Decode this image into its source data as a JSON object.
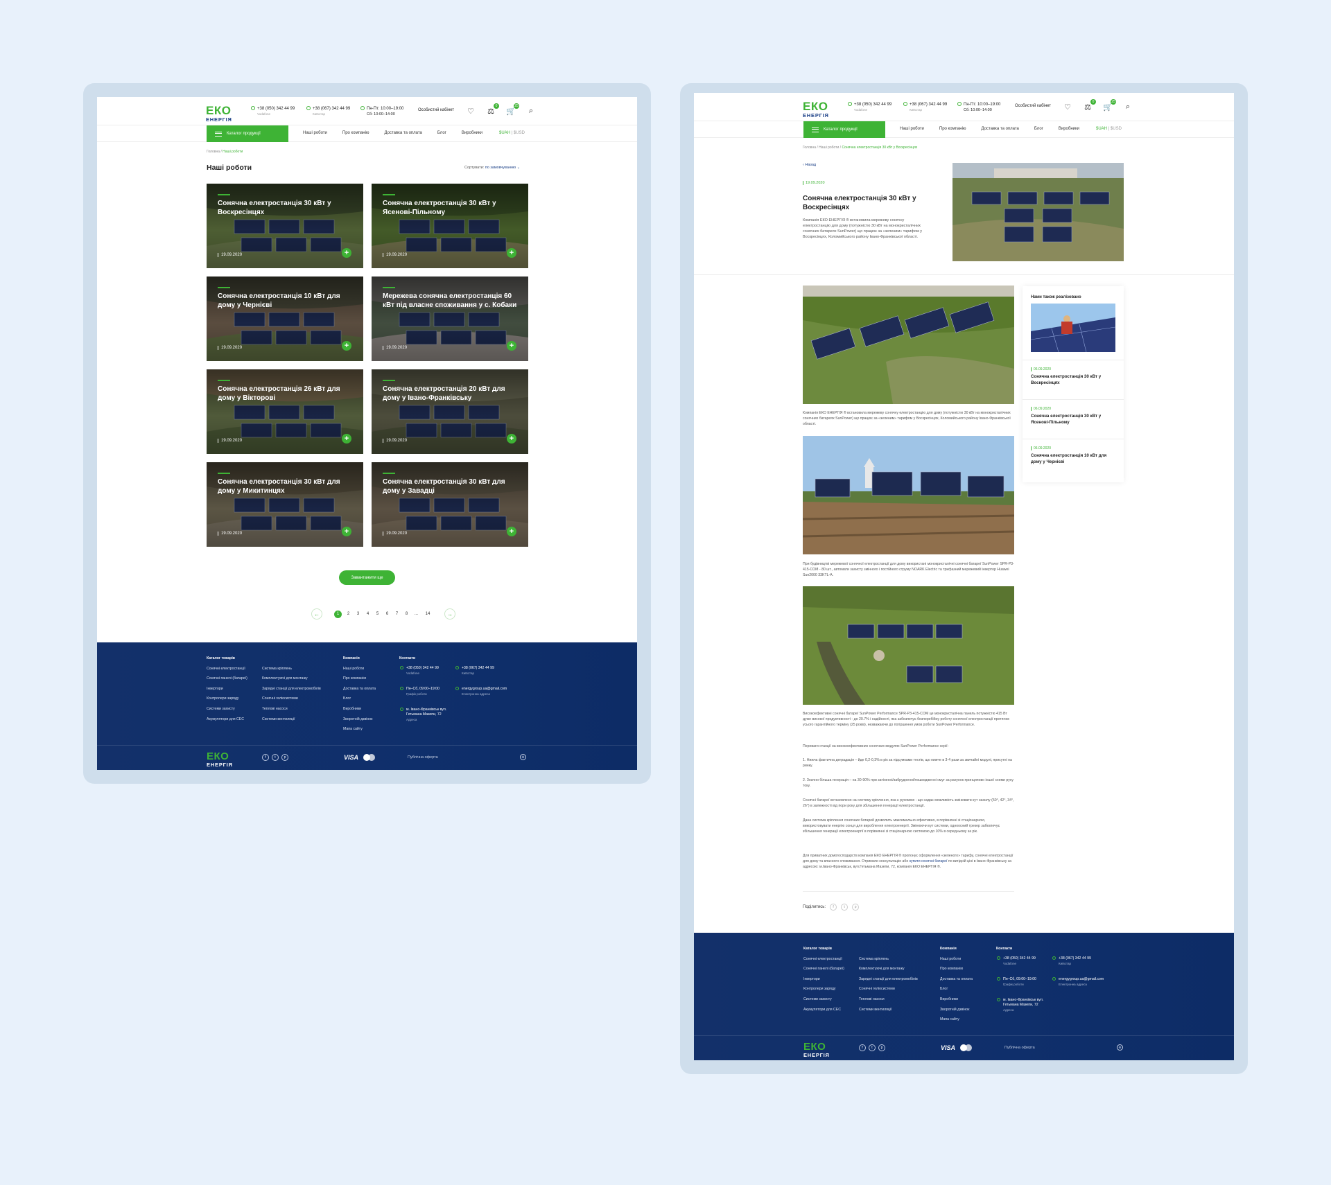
{
  "header": {
    "logo_top": "ЕКО",
    "logo_bottom": "ЕНЕРГІЯ",
    "phone1": "+38 (050) 342 44 99",
    "phone1_sub": "Vodafone",
    "phone2": "+38 (067) 342 44 99",
    "phone2_sub": "Київстар",
    "hours1": "Пн-Пт: 10:00–19:00",
    "hours2": "Сб: 10:00–14:00",
    "cabinet": "Особистий кабінет",
    "compare_count": "0",
    "cart_count": "25"
  },
  "nav": {
    "catalog": "Каталог продукції",
    "items": [
      "Наші роботи",
      "Про компанію",
      "Доставка та оплата",
      "Блог",
      "Виробники"
    ],
    "cur_uah": "$UAH",
    "cur_sep": "|",
    "cur_usd": "$USD"
  },
  "list_page": {
    "breadcrumb_home": "Головна",
    "breadcrumb_sep": " / ",
    "breadcrumb_current": "Наші роботи",
    "title": "Наші роботи",
    "sort_label": "Сортувати:",
    "sort_value": "по замовчуванню ⌄",
    "cards": [
      {
        "title": "Сонячна електростанція 30 кВт у Воскресінцях",
        "date": "19.09.2020"
      },
      {
        "title": "Сонячна електростанція 30 кВт у Ясенові-Пільному",
        "date": "19.09.2020"
      },
      {
        "title": "Сонячна електростанція 10 кВт для дому у Чернієві",
        "date": "19.09.2020"
      },
      {
        "title": "Мережева сонячна електростанція 60 кВт під власне споживання у с. Кобаки",
        "date": "19.09.2020"
      },
      {
        "title": "Сонячна електростанція 26 кВт для дому у Вікторові",
        "date": "19.09.2020"
      },
      {
        "title": "Сонячна електростанція 20 кВт для дому у Івано-Франківську",
        "date": "19.09.2020"
      },
      {
        "title": "Сонячна електростанція 30 кВт для дому у Микитинцях",
        "date": "19.09.2020"
      },
      {
        "title": "Сонячна електростанція 30 кВт для дому у Завадці",
        "date": "19.09.2020"
      }
    ],
    "load_more": "Завантажити ще",
    "pages": [
      "1",
      "2",
      "3",
      "4",
      "5",
      "6",
      "7",
      "8",
      "...",
      "14"
    ],
    "prev": "←",
    "next": "→"
  },
  "detail_page": {
    "breadcrumb_home": "Головна",
    "breadcrumb_works": "Наші роботи",
    "breadcrumb_current": "Сонячна електростанція 30 кВт у Воскресінцях",
    "back": "Назад",
    "date": "19.09.2020",
    "title": "Сонячна електростанція 30 кВт у Воскресінцях",
    "lead": "Компанія ЕКО ЕНЕРГІЯ ® встановила мережеву сонячну електростанцію для дому (потужністю 30 кВт на монокристалічних сонячних батареях SunPower) що працює за «зеленим» тарифом у Воскресінцях, Коломийського району Івано-Франківської області.",
    "p1": "Компанія ЕКО ЕНЕРГІЯ ® встановила мережеву сонячну електростанцію для дому (потужністю 30 кВт на монокристалічних сонячних батареях SunPower) що працює за «зеленим» тарифом у Воскресінцях, Коломийського району Івано-Франківської області.",
    "p2": "При будівництві мережевої сонячної електростанції для дому використані монокристалічні сонячні батареї SunPower SPR-P3-415-COM - 80 шт., автомати захисту змінного і постійного струму NOARK Electric та трифазний мережевий інвертор Huawei Sun2000 33KTL-A.",
    "p3": "Високоефективні сонячні батареї SunPower Performance SPR-P3-415-COM це монокристалічна панель потужністю 415 Вт дуже високої продуктивності - до 20.7% і надійності, яка забезпечує безперебійну роботу сонячної електростанції протягом усього гарантійного терміну (25 років), незважаючи до погіршення умов роботи SunPower Performance.",
    "p4": "Переваги станції на високоефективних сонячних модулях SunPower Performance серії:",
    "p5": "1. Нижча фактична деградація – йде 0,2-0,3% в рік за підсумками тестів, що нижче в 3-4 рази за звичайні модулі, присутні на ринку.",
    "p6": "2. Значно більша генерація – на 30-90% при затіненні/забрудненні/пошкодженні смуг за рахунок принципово іншої схеми руху току.",
    "p7": "Сонячні батареї встановлено на систему кріплення, яка є рухомою - що надає можливість змінювати кут нахилу (50°, 42°, 34°, 26°) в залежності від пори року для збільшення генерації електростанції.",
    "p8": "Дана система кріплення сонячних батарей дозволить максимально ефективно, в порівнянні зі стаціонарною, використовувати енергію сонця для вироблення електроенергії. Змінюючи кут системи, одноосний трекер забезпечує збільшення генерації електроенергії в порівнянні зі стаціонарною системою до 10% в середньому за рік.",
    "p9a": "Для приватних домогосподарств компанія ЕКО ЕНЕРГІЯ ® пропонує оформлення «зеленого» тарифу, сонячні електростанції для дому та власного споживання. Отримати консультацію або ",
    "p9link": "купити сонячні батареї",
    "p9b": " по вигідній ціні в Івано-Франківську за адресою: м.Івано-Франківськ, вул.Гетьмана Мазепи, 72, компанія ЕКО ЕНЕРГІЯ ®.",
    "share": "Поділитись:",
    "sidebar_title": "Нами також реалізовано",
    "sidebar_items": [
      {
        "date": "06.09.2020",
        "title": "Сонячна електростанція 30 кВт у Воскресінцях"
      },
      {
        "date": "06.09.2020",
        "title": "Сонячна електростанція 30 кВт у Ясенові-Пільному"
      },
      {
        "date": "06.09.2020",
        "title": "Сонячна електростанція 10 кВт для дому у Чернієві"
      }
    ]
  },
  "footer": {
    "catalog_title": "Каталог товарів",
    "catalog_col1": [
      "Сонячні електростанції",
      "Сонячні панелі (батареї)",
      "Інвертори",
      "Контролери заряду",
      "Системи захисту",
      "Акумулятори для СЕС"
    ],
    "catalog_col2": [
      "Система кріплень",
      "Комплектуючі для монтажу",
      "Зарядні станції для електромобілів",
      "Сонячні геліосистеми",
      "Теплові насоси",
      "Системи вентиляції"
    ],
    "company_title": "Компанія",
    "company": [
      "Наші роботи",
      "Про компанію",
      "Доставка та оплата",
      "Блог",
      "Виробники",
      "Зворотній дзвінок",
      "Мапа сайту"
    ],
    "contacts_title": "Контакти",
    "phone1": "+38 (050) 342 44 99",
    "phone1_sub": "Vodafone",
    "phone2": "+38 (067) 342 44 99",
    "phone2_sub": "Київстар",
    "hours": "Пн–Сб, 09:00–19:00",
    "hours_sub": "Графік роботи",
    "email": "energygroup.ua@gmail.com",
    "email_sub": "Електронна адреса",
    "address": "м. Івано-Франківськ вул. Гетьмана Мазепи, 72",
    "address_sub": "Адреса",
    "visa": "VISA",
    "offer": "Публічна оферта"
  },
  "colors": {
    "accent": "#3eb335",
    "brand_blue": "#0f2f6b",
    "background": "#e8f1fb"
  }
}
